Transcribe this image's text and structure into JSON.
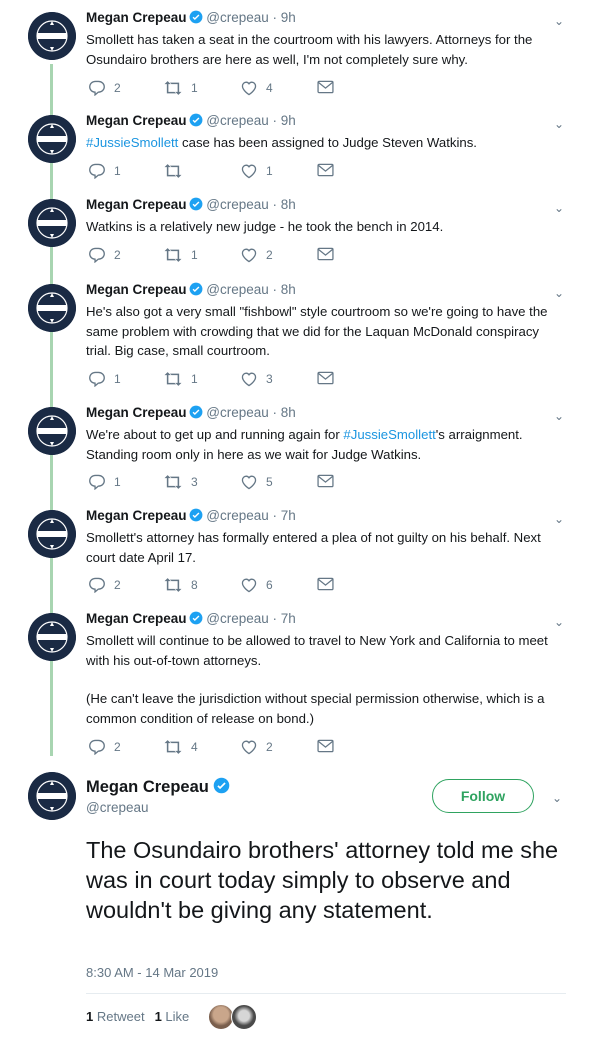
{
  "author": {
    "name": "Megan Crepeau",
    "handle": "@crepeau"
  },
  "colors": {
    "link": "#1b95e0",
    "verified": "#1da1f2",
    "follow": "#2fa360",
    "thread_line": "#a8d5b1"
  },
  "tweets": [
    {
      "time": "9h",
      "text": "Smollett has taken a seat in the courtroom with his lawyers. Attorneys for the Osundairo brothers are here as well, I'm not completely sure why.",
      "replies": "2",
      "retweets": "1",
      "likes": "4"
    },
    {
      "time": "9h",
      "hashtag": "#JussieSmollett",
      "text_after": " case has been assigned to Judge Steven Watkins.",
      "replies": "1",
      "retweets": "",
      "likes": "1"
    },
    {
      "time": "8h",
      "text": "Watkins is a relatively new judge - he took the bench in 2014.",
      "replies": "2",
      "retweets": "1",
      "likes": "2"
    },
    {
      "time": "8h",
      "text": "He's also got a very small \"fishbowl\" style courtroom so we're going to have the same problem with crowding that we did for the Laquan McDonald conspiracy trial. Big case, small courtroom.",
      "replies": "1",
      "retweets": "1",
      "likes": "3"
    },
    {
      "time": "8h",
      "text_before": "We're about to get up and running again for ",
      "hashtag": "#JussieSmollett",
      "text_after": "'s arraignment. Standing room only in here as we wait for Judge Watkins.",
      "replies": "1",
      "retweets": "3",
      "likes": "5"
    },
    {
      "time": "7h",
      "text": "Smollett's attorney has formally entered a plea of not guilty on his behalf. Next court date April 17.",
      "replies": "2",
      "retweets": "8",
      "likes": "6"
    },
    {
      "time": "7h",
      "text": "Smollett will continue to be allowed to travel to New York and California to meet with his out-of-town attorneys.",
      "text2": "(He can't leave the jurisdiction without special permission otherwise, which is a common condition of release on bond.)",
      "replies": "2",
      "retweets": "4",
      "likes": "2"
    }
  ],
  "main": {
    "follow_label": "Follow",
    "text": "The Osundairo brothers' attorney told me she was in court today simply to observe and wouldn't be giving any statement.",
    "timestamp": "8:30 AM - 14 Mar 2019",
    "retweet_count": "1",
    "retweet_label": "Retweet",
    "like_count": "1",
    "like_label": "Like"
  },
  "icons": {
    "reply": "reply-icon",
    "retweet": "retweet-icon",
    "like": "heart-icon",
    "dm": "envelope-icon",
    "menu": "chevron-down-icon",
    "verified": "verified-badge-icon"
  }
}
